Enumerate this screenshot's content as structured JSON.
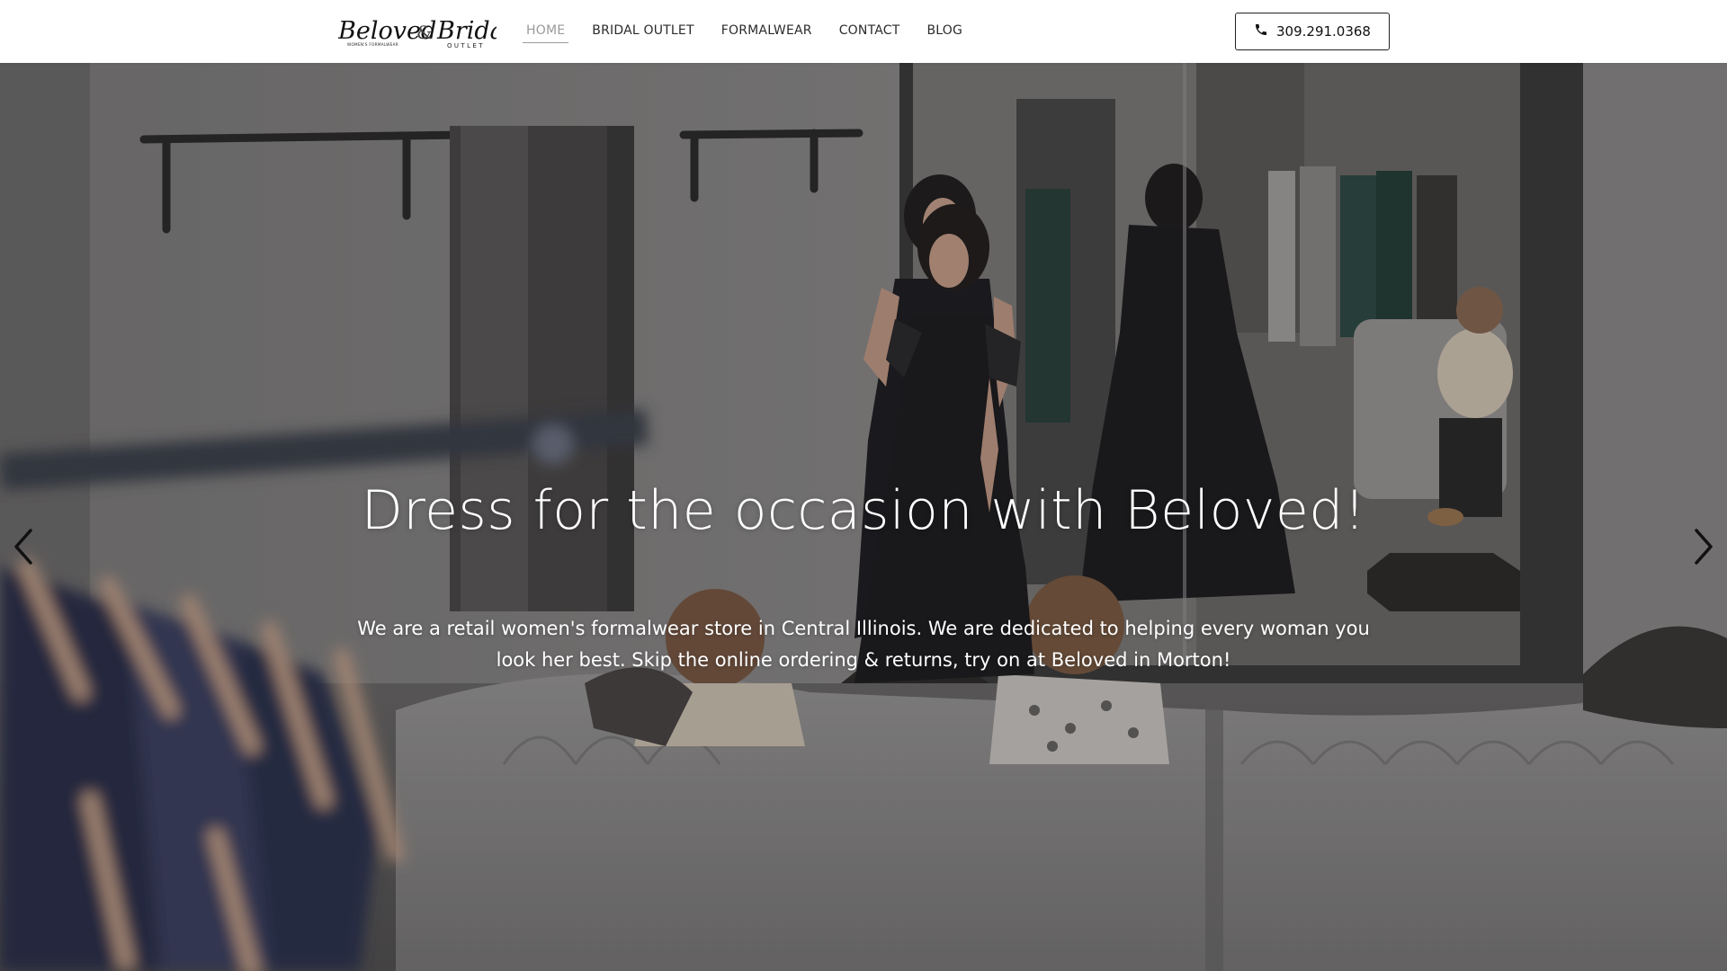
{
  "brand": {
    "logo_text": "Beloved & Bridal Outlet",
    "logo_part1": "Beloved",
    "logo_amp": "&",
    "logo_part2": "Bridal",
    "logo_tag1": "WOMEN'S FORMALWEAR",
    "logo_tag2": "OUTLET"
  },
  "nav": {
    "items": [
      {
        "label": "HOME",
        "active": true
      },
      {
        "label": "BRIDAL OUTLET",
        "active": false
      },
      {
        "label": "FORMALWEAR",
        "active": false
      },
      {
        "label": "CONTACT",
        "active": false
      },
      {
        "label": "BLOG",
        "active": false
      }
    ],
    "active_color": "#9a9a9a"
  },
  "phone": {
    "number": "309.291.0368",
    "icon": "phone-icon"
  },
  "hero": {
    "title": "Dress for the occasion with Beloved!",
    "subtitle": "We are a retail women's formalwear store in Central Illinois. We are dedicated to helping every woman you look her best. Skip the online ordering & returns, try on at Beloved in Morton!",
    "prev_icon": "chevron-left-icon",
    "next_icon": "chevron-right-icon"
  },
  "colors": {
    "text_dark": "#2b2b2b",
    "hero_text": "#ffffff"
  }
}
